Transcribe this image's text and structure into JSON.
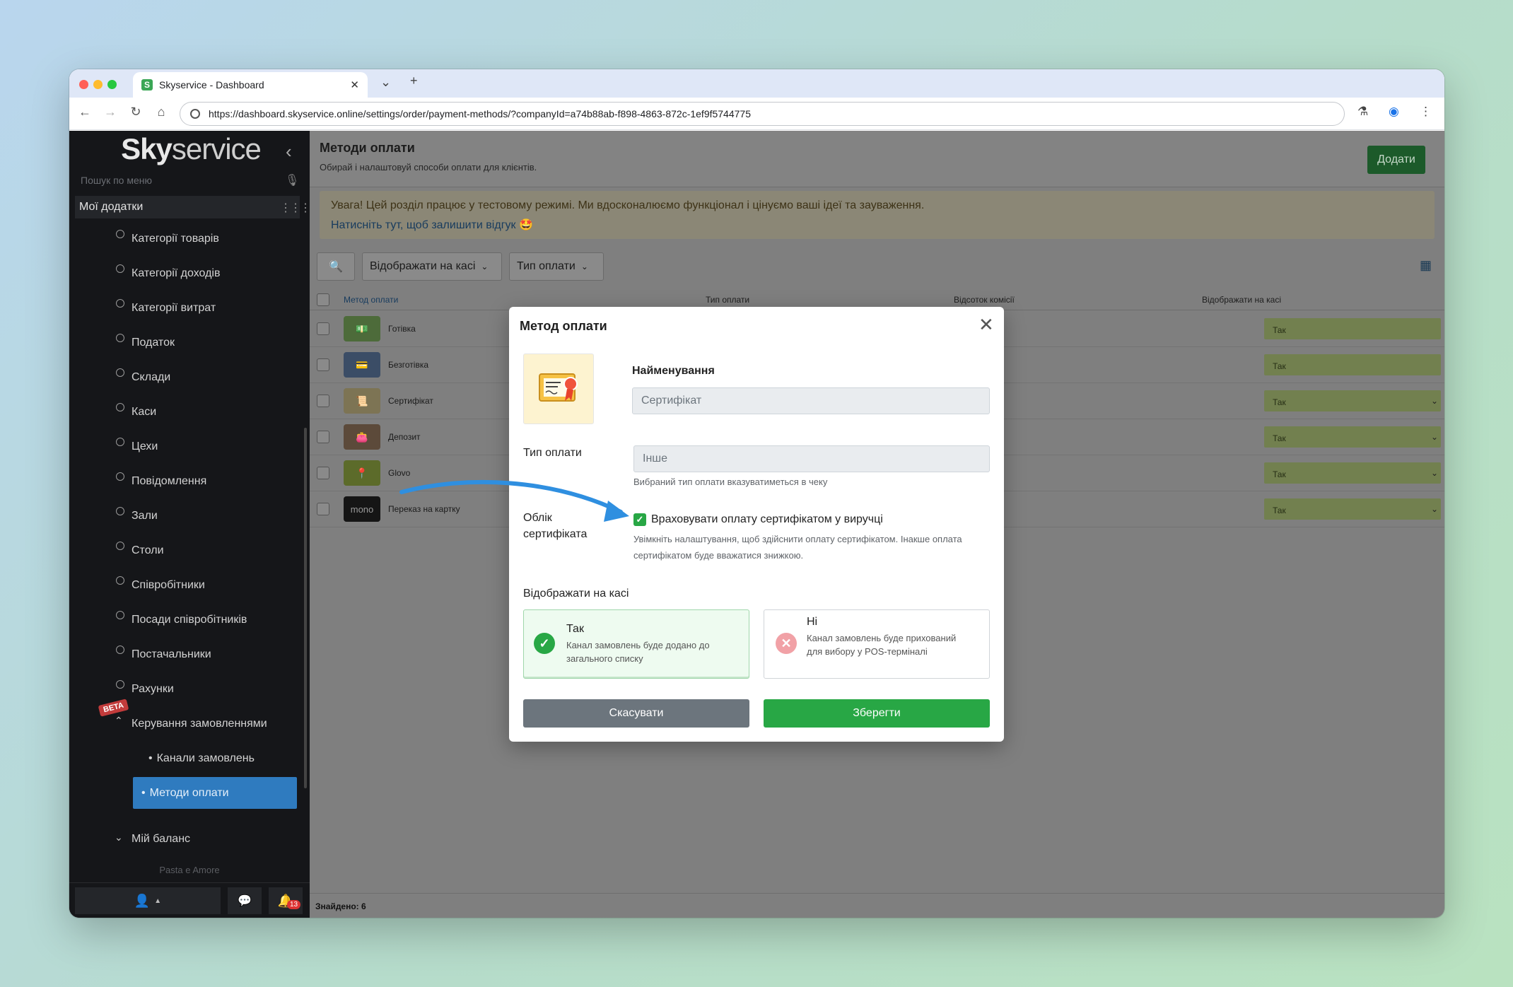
{
  "browser": {
    "tab_title": "Skyservice - Dashboard",
    "url": "https://dashboard.skyservice.online/settings/order/payment-methods/?companyId=a74b88ab-f898-4863-872c-1ef9f5744775"
  },
  "sidebar": {
    "logo_bold": "Sky",
    "logo_rest": "service",
    "search_placeholder": "Пошук по меню",
    "my_apps": "Мої додатки",
    "items": [
      {
        "label": "Категорії товарів"
      },
      {
        "label": "Категорії доходів"
      },
      {
        "label": "Категорії витрат"
      },
      {
        "label": "Податок"
      },
      {
        "label": "Склади"
      },
      {
        "label": "Каси"
      },
      {
        "label": "Цехи"
      },
      {
        "label": "Повідомлення"
      },
      {
        "label": "Зали"
      },
      {
        "label": "Столи"
      },
      {
        "label": "Співробітники"
      },
      {
        "label": "Посади співробітників"
      },
      {
        "label": "Постачальники"
      },
      {
        "label": "Рахунки"
      }
    ],
    "beta": "BETA",
    "orders_group": "Керування замовленнями",
    "sub_channels": "Канали замовлень",
    "sub_payment": "Методи оплати",
    "balance": "Мій баланс",
    "company": "Pasta e Amore",
    "notifications": "13"
  },
  "main": {
    "title": "Методи оплати",
    "subtitle": "Обирай і налаштовуй способи оплати для клієнтів.",
    "add_button": "Додати",
    "alert_text": "Увага! Цей розділ працює у тестовому режимі. Ми вдосконалюємо функціонал і цінуємо ваші ідеї та зауваження.",
    "alert_link": "Натисніть тут, щоб залишити відгук 🤩",
    "filter_show": "Відображати на касі",
    "filter_type": "Тип оплати",
    "columns": [
      "Метод оплати",
      "Тип оплати",
      "Відсоток комісії",
      "Відображати на касі"
    ],
    "rows": [
      {
        "name": "Готівка",
        "show": "Так"
      },
      {
        "name": "Безготівка",
        "show": "Так"
      },
      {
        "name": "Сертифікат",
        "show": "Так"
      },
      {
        "name": "Депозит",
        "show": "Так"
      },
      {
        "name": "Glovo",
        "show": "Так"
      },
      {
        "name": "Переказ на картку",
        "show": "Так",
        "thumb_text": "mono"
      }
    ],
    "found": "Знайдено: 6"
  },
  "modal": {
    "title": "Метод оплати",
    "name_label": "Найменування",
    "name_value": "Сертифікат",
    "type_label": "Тип оплати",
    "type_value": "Інше",
    "type_hint": "Вибраний тип оплати вказуватиметься в чеку",
    "cert_label_1": "Облік",
    "cert_label_2": "сертифіката",
    "cert_checkbox": "Враховувати оплату сертифікатом у виручці",
    "cert_hint_1": "Увімкніть налаштування, щоб здійснити оплату сертифікатом. Інакше оплата",
    "cert_hint_2": "сертифікатом буде вважатися знижкою.",
    "show_label": "Відображати на касі",
    "yes_title": "Так",
    "yes_desc": "Канал замовлень буде додано до загального списку",
    "no_title": "Ні",
    "no_desc": "Канал замовлень буде прихований для вибору у POS-терміналі",
    "cancel": "Скасувати",
    "save": "Зберегти"
  },
  "colors": {
    "accent_green": "#28a745",
    "sidebar_active": "#2f7bbf",
    "sidebar_bg": "#151619"
  }
}
